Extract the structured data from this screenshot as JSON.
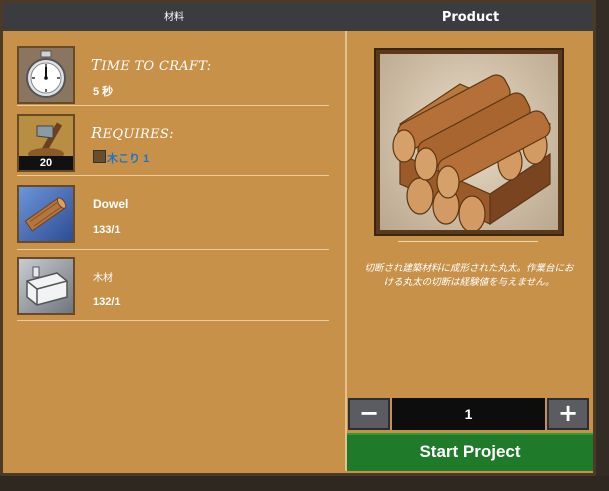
{
  "tabs": {
    "materials_label": "材料",
    "product_label": "Product"
  },
  "left": {
    "craft_time": {
      "title": "Time to craft:",
      "value": "5 秒",
      "icon": "stopwatch-icon"
    },
    "requires": {
      "title": "Requires:",
      "skill": "木こり",
      "level": "1",
      "badge": "20",
      "icon": "woodcutting-icon"
    },
    "materials": [
      {
        "name": "Dowel",
        "count": "133/1",
        "icon": "dowel-icon"
      },
      {
        "name": "木材",
        "count": "132/1",
        "icon": "lumber-icon"
      }
    ]
  },
  "right": {
    "product_icon": "log-stack-icon",
    "description": "切断され建築材料に成形された丸太。作業台における丸太の切断は経験値を与えません。",
    "quantity": "1",
    "minus_label": "−",
    "plus_label": "+",
    "start_label": "Start Project"
  },
  "colors": {
    "panel": "#c8914a",
    "tabbar": "#3a3c40",
    "start": "#1f7a2a",
    "link": "#1b74c8"
  }
}
